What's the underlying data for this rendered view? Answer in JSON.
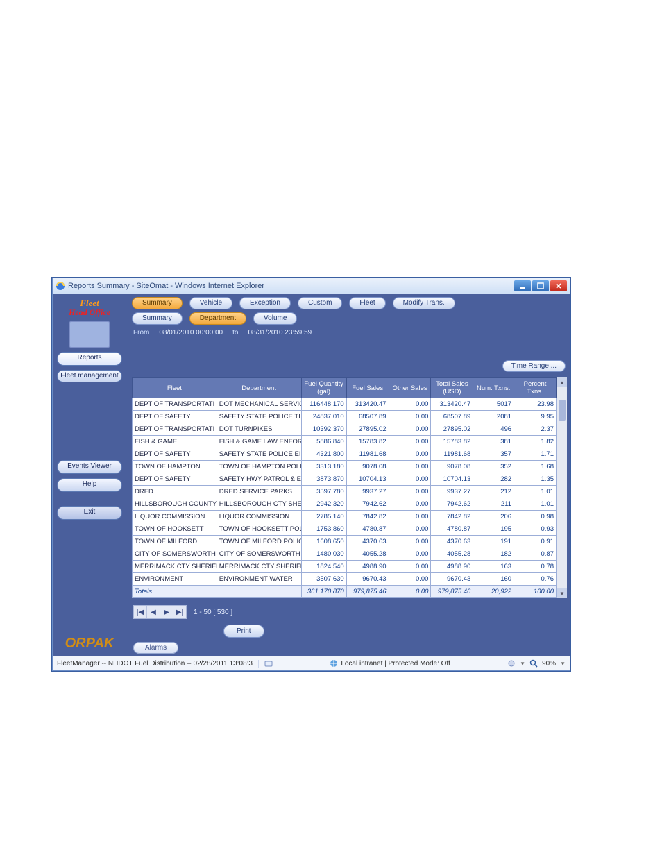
{
  "window_title": "Reports Summary - SiteOmat - Windows Internet Explorer",
  "brand": {
    "line1": "Fleet",
    "line2": "Head Office"
  },
  "sidebar": {
    "reports": "Reports",
    "fleet_mgmt": "Fleet management",
    "events_viewer": "Events Viewer",
    "help": "Help",
    "exit": "Exit"
  },
  "orpak": "ORPAK",
  "tabs_primary": [
    {
      "label": "Summary",
      "selected": true
    },
    {
      "label": "Vehicle",
      "selected": false
    },
    {
      "label": "Exception",
      "selected": false
    },
    {
      "label": "Custom",
      "selected": false
    },
    {
      "label": "Fleet",
      "selected": false
    },
    {
      "label": "Modify Trans.",
      "selected": false
    }
  ],
  "tabs_secondary": [
    {
      "label": "Summary",
      "selected": false
    },
    {
      "label": "Department",
      "selected": true
    },
    {
      "label": "Volume",
      "selected": false
    }
  ],
  "dates": {
    "from_lbl": "From",
    "from_val": "08/01/2010 00:00:00",
    "to_lbl": "to",
    "to_val": "08/31/2010 23:59:59"
  },
  "timerange_btn": "Time Range ...",
  "columns": [
    "Fleet",
    "Department",
    "Fuel Quantity (gal)",
    "Fuel Sales",
    "Other Sales",
    "Total Sales (USD)",
    "Num. Txns.",
    "Percent Txns."
  ],
  "rows": [
    {
      "c": [
        "DEPT OF TRANSPORTATI",
        "DOT MECHANICAL SERVIC",
        "116448.170",
        "313420.47",
        "0.00",
        "313420.47",
        "5017",
        "23.98"
      ]
    },
    {
      "c": [
        "DEPT OF SAFETY",
        "SAFETY STATE POLICE TI",
        "24837.010",
        "68507.89",
        "0.00",
        "68507.89",
        "2081",
        "9.95"
      ]
    },
    {
      "c": [
        "DEPT OF TRANSPORTATI",
        "DOT TURNPIKES",
        "10392.370",
        "27895.02",
        "0.00",
        "27895.02",
        "496",
        "2.37"
      ]
    },
    {
      "c": [
        "FISH & GAME",
        "FISH & GAME LAW ENFOR",
        "5886.840",
        "15783.82",
        "0.00",
        "15783.82",
        "381",
        "1.82"
      ]
    },
    {
      "c": [
        "DEPT OF SAFETY",
        "SAFETY STATE POLICE EI",
        "4321.800",
        "11981.68",
        "0.00",
        "11981.68",
        "357",
        "1.71"
      ]
    },
    {
      "c": [
        "TOWN OF HAMPTON",
        "TOWN OF HAMPTON POLI",
        "3313.180",
        "9078.08",
        "0.00",
        "9078.08",
        "352",
        "1.68"
      ]
    },
    {
      "c": [
        "DEPT OF SAFETY",
        "SAFETY HWY PATROL & E",
        "3873.870",
        "10704.13",
        "0.00",
        "10704.13",
        "282",
        "1.35"
      ]
    },
    {
      "c": [
        "DRED",
        "DRED SERVICE PARKS",
        "3597.780",
        "9937.27",
        "0.00",
        "9937.27",
        "212",
        "1.01"
      ]
    },
    {
      "c": [
        "HILLSBOROUGH COUNTY",
        "HILLSBOROUGH CTY SHEI",
        "2942.320",
        "7942.62",
        "0.00",
        "7942.62",
        "211",
        "1.01"
      ]
    },
    {
      "c": [
        "LIQUOR COMMISSION",
        "LIQUOR COMMISSION",
        "2785.140",
        "7842.82",
        "0.00",
        "7842.82",
        "206",
        "0.98"
      ]
    },
    {
      "c": [
        "TOWN OF HOOKSETT",
        "TOWN OF HOOKSETT POL",
        "1753.860",
        "4780.87",
        "0.00",
        "4780.87",
        "195",
        "0.93"
      ]
    },
    {
      "c": [
        "TOWN OF MILFORD",
        "TOWN OF MILFORD POLIC",
        "1608.650",
        "4370.63",
        "0.00",
        "4370.63",
        "191",
        "0.91"
      ]
    },
    {
      "c": [
        "CITY OF SOMERSWORTH",
        "CITY OF SOMERSWORTH",
        "1480.030",
        "4055.28",
        "0.00",
        "4055.28",
        "182",
        "0.87"
      ]
    },
    {
      "c": [
        "MERRIMACK CTY SHERIFF",
        "MERRIMACK CTY SHERIFF",
        "1824.540",
        "4988.90",
        "0.00",
        "4988.90",
        "163",
        "0.78"
      ]
    },
    {
      "c": [
        "ENVIRONMENT",
        "ENVIRONMENT WATER",
        "3507.630",
        "9670.43",
        "0.00",
        "9670.43",
        "160",
        "0.76"
      ]
    }
  ],
  "totals": {
    "label": "Totals",
    "values": [
      "361,170.870",
      "979,875.46",
      "0.00",
      "979,875.46",
      "20,922",
      "100.00"
    ]
  },
  "pager": {
    "range": "1 - 50  [ 530 ]"
  },
  "print_btn": "Print",
  "alarms_btn": "Alarms",
  "status": {
    "left": "FleetManager -- NHDOT Fuel Distribution -- 02/28/2011 13:08:3",
    "mid": "Local intranet | Protected Mode: Off",
    "zoom": "90%"
  }
}
